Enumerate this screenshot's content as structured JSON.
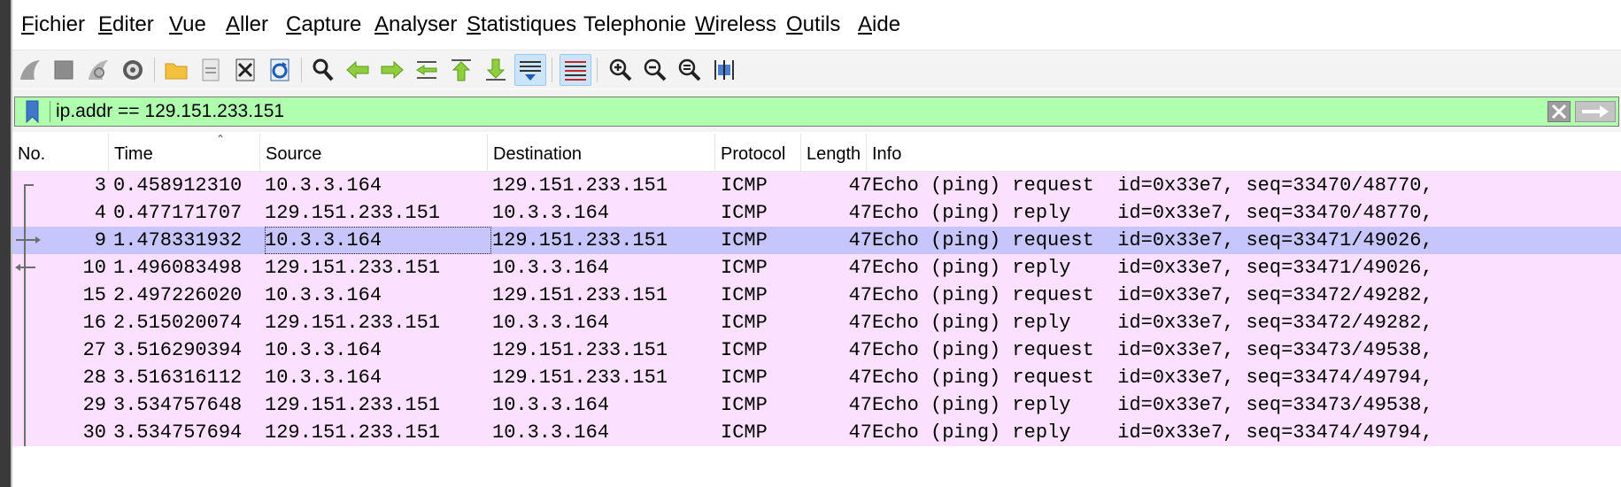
{
  "menu": [
    {
      "first": "F",
      "rest": "ichier"
    },
    {
      "first": "E",
      "rest": "diter"
    },
    {
      "first": "V",
      "rest": "ue"
    },
    {
      "first": "A",
      "rest": "ller"
    },
    {
      "first": "C",
      "rest": "apture"
    },
    {
      "first": "A",
      "rest": "nalyser"
    },
    {
      "first": "S",
      "rest": "tatistiques"
    },
    {
      "first": "",
      "rest": "Telephonie"
    },
    {
      "first": "W",
      "rest": "ireless"
    },
    {
      "first": "O",
      "rest": "utils"
    },
    {
      "first": "A",
      "rest": "ide"
    }
  ],
  "toolbar": {
    "icons": [
      "shark-fin-start-icon",
      "stop-square-icon",
      "shark-fin-restart-icon",
      "gear-options-icon",
      "folder-open-icon",
      "file-save-icon",
      "file-close-icon",
      "reload-icon",
      "find-magnifier-icon",
      "go-back-arrow-icon",
      "go-forward-arrow-icon",
      "go-to-packet-icon",
      "first-packet-icon",
      "last-packet-icon",
      "autoscroll-icon",
      "colorize-icon",
      "zoom-in-icon",
      "zoom-out-icon",
      "zoom-normal-icon",
      "resize-columns-icon"
    ]
  },
  "filter": {
    "value": "ip.addr == 129.151.233.151",
    "background": "#afffaf"
  },
  "columns": [
    "No.",
    "Time",
    "Source",
    "Destination",
    "Protocol",
    "Length",
    "Info"
  ],
  "rows": [
    {
      "no": "3",
      "time": "0.458912310",
      "src": "10.3.3.164",
      "dst": "129.151.233.151",
      "proto": "ICMP",
      "len": "47",
      "info": "Echo (ping) request  id=0x33e7, seq=33470/48770,"
    },
    {
      "no": "4",
      "time": "0.477171707",
      "src": "129.151.233.151",
      "dst": "10.3.3.164",
      "proto": "ICMP",
      "len": "47",
      "info": "Echo (ping) reply    id=0x33e7, seq=33470/48770,"
    },
    {
      "no": "9",
      "time": "1.478331932",
      "src": "10.3.3.164",
      "dst": "129.151.233.151",
      "proto": "ICMP",
      "len": "47",
      "info": "Echo (ping) request  id=0x33e7, seq=33471/49026,"
    },
    {
      "no": "10",
      "time": "1.496083498",
      "src": "129.151.233.151",
      "dst": "10.3.3.164",
      "proto": "ICMP",
      "len": "47",
      "info": "Echo (ping) reply    id=0x33e7, seq=33471/49026,"
    },
    {
      "no": "15",
      "time": "2.497226020",
      "src": "10.3.3.164",
      "dst": "129.151.233.151",
      "proto": "ICMP",
      "len": "47",
      "info": "Echo (ping) request  id=0x33e7, seq=33472/49282,"
    },
    {
      "no": "16",
      "time": "2.515020074",
      "src": "129.151.233.151",
      "dst": "10.3.3.164",
      "proto": "ICMP",
      "len": "47",
      "info": "Echo (ping) reply    id=0x33e7, seq=33472/49282,"
    },
    {
      "no": "27",
      "time": "3.516290394",
      "src": "10.3.3.164",
      "dst": "129.151.233.151",
      "proto": "ICMP",
      "len": "47",
      "info": "Echo (ping) request  id=0x33e7, seq=33473/49538,"
    },
    {
      "no": "28",
      "time": "3.516316112",
      "src": "10.3.3.164",
      "dst": "129.151.233.151",
      "proto": "ICMP",
      "len": "47",
      "info": "Echo (ping) request  id=0x33e7, seq=33474/49794,"
    },
    {
      "no": "29",
      "time": "3.534757648",
      "src": "129.151.233.151",
      "dst": "10.3.3.164",
      "proto": "ICMP",
      "len": "47",
      "info": "Echo (ping) reply    id=0x33e7, seq=33473/49538,"
    },
    {
      "no": "30",
      "time": "3.534757694",
      "src": "129.151.233.151",
      "dst": "10.3.3.164",
      "proto": "ICMP",
      "len": "47",
      "info": "Echo (ping) reply    id=0x33e7, seq=33474/49794,"
    }
  ],
  "selected_row": 2,
  "colors": {
    "row_icmp": "#fce0ff",
    "row_selected": "#c6c6fc"
  }
}
